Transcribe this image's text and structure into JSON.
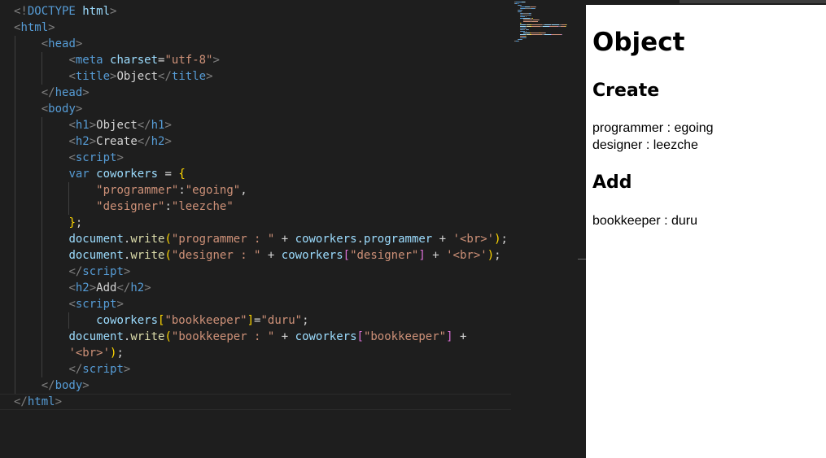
{
  "editor": {
    "lines": [
      [
        {
          "c": "c-br",
          "t": "<!"
        },
        {
          "c": "c-tag",
          "t": "DOCTYPE "
        },
        {
          "c": "c-attr",
          "t": "html"
        },
        {
          "c": "c-br",
          "t": ">"
        }
      ],
      [
        {
          "c": "c-br",
          "t": "<"
        },
        {
          "c": "c-tag",
          "t": "html"
        },
        {
          "c": "c-br",
          "t": ">"
        }
      ],
      [
        {
          "c": "c-txt",
          "t": "    "
        },
        {
          "c": "c-br",
          "t": "<"
        },
        {
          "c": "c-tag",
          "t": "head"
        },
        {
          "c": "c-br",
          "t": ">"
        }
      ],
      [
        {
          "c": "c-txt",
          "t": "        "
        },
        {
          "c": "c-br",
          "t": "<"
        },
        {
          "c": "c-tag",
          "t": "meta "
        },
        {
          "c": "c-attr",
          "t": "charset"
        },
        {
          "c": "c-txt",
          "t": "="
        },
        {
          "c": "c-str",
          "t": "\"utf-8\""
        },
        {
          "c": "c-br",
          "t": ">"
        }
      ],
      [
        {
          "c": "c-txt",
          "t": "        "
        },
        {
          "c": "c-br",
          "t": "<"
        },
        {
          "c": "c-tag",
          "t": "title"
        },
        {
          "c": "c-br",
          "t": ">"
        },
        {
          "c": "c-txt",
          "t": "Object"
        },
        {
          "c": "c-br",
          "t": "</"
        },
        {
          "c": "c-tag",
          "t": "title"
        },
        {
          "c": "c-br",
          "t": ">"
        }
      ],
      [
        {
          "c": "c-txt",
          "t": "    "
        },
        {
          "c": "c-br",
          "t": "</"
        },
        {
          "c": "c-tag",
          "t": "head"
        },
        {
          "c": "c-br",
          "t": ">"
        }
      ],
      [
        {
          "c": "c-txt",
          "t": "    "
        },
        {
          "c": "c-br",
          "t": "<"
        },
        {
          "c": "c-tag",
          "t": "body"
        },
        {
          "c": "c-br",
          "t": ">"
        }
      ],
      [
        {
          "c": "c-txt",
          "t": "        "
        },
        {
          "c": "c-br",
          "t": "<"
        },
        {
          "c": "c-tag",
          "t": "h1"
        },
        {
          "c": "c-br",
          "t": ">"
        },
        {
          "c": "c-txt",
          "t": "Object"
        },
        {
          "c": "c-br",
          "t": "</"
        },
        {
          "c": "c-tag",
          "t": "h1"
        },
        {
          "c": "c-br",
          "t": ">"
        }
      ],
      [
        {
          "c": "c-txt",
          "t": "        "
        },
        {
          "c": "c-br",
          "t": "<"
        },
        {
          "c": "c-tag",
          "t": "h2"
        },
        {
          "c": "c-br",
          "t": ">"
        },
        {
          "c": "c-txt",
          "t": "Create"
        },
        {
          "c": "c-br",
          "t": "</"
        },
        {
          "c": "c-tag",
          "t": "h2"
        },
        {
          "c": "c-br",
          "t": ">"
        }
      ],
      [
        {
          "c": "c-txt",
          "t": "        "
        },
        {
          "c": "c-br",
          "t": "<"
        },
        {
          "c": "c-tag",
          "t": "script"
        },
        {
          "c": "c-br",
          "t": ">"
        }
      ],
      [
        {
          "c": "c-txt",
          "t": "        "
        },
        {
          "c": "c-kw",
          "t": "var "
        },
        {
          "c": "c-var",
          "t": "coworkers"
        },
        {
          "c": "c-txt",
          "t": " = "
        },
        {
          "c": "c-b1",
          "t": "{"
        }
      ],
      [
        {
          "c": "c-txt",
          "t": "            "
        },
        {
          "c": "c-str",
          "t": "\"programmer\""
        },
        {
          "c": "c-txt",
          "t": ":"
        },
        {
          "c": "c-str",
          "t": "\"egoing\""
        },
        {
          "c": "c-txt",
          "t": ","
        }
      ],
      [
        {
          "c": "c-txt",
          "t": "            "
        },
        {
          "c": "c-str",
          "t": "\"designer\""
        },
        {
          "c": "c-txt",
          "t": ":"
        },
        {
          "c": "c-str",
          "t": "\"leezche\""
        }
      ],
      [
        {
          "c": "c-txt",
          "t": "        "
        },
        {
          "c": "c-b1",
          "t": "}"
        },
        {
          "c": "c-txt",
          "t": ";"
        }
      ],
      [
        {
          "c": "c-txt",
          "t": "        "
        },
        {
          "c": "c-var",
          "t": "document"
        },
        {
          "c": "c-txt",
          "t": "."
        },
        {
          "c": "c-fn",
          "t": "write"
        },
        {
          "c": "c-b1",
          "t": "("
        },
        {
          "c": "c-str",
          "t": "\"programmer : \""
        },
        {
          "c": "c-txt",
          "t": " + "
        },
        {
          "c": "c-var",
          "t": "coworkers"
        },
        {
          "c": "c-txt",
          "t": "."
        },
        {
          "c": "c-var",
          "t": "programmer"
        },
        {
          "c": "c-txt",
          "t": " + "
        },
        {
          "c": "c-str",
          "t": "'<br>'"
        },
        {
          "c": "c-b1",
          "t": ")"
        },
        {
          "c": "c-txt",
          "t": ";"
        }
      ],
      [
        {
          "c": "c-txt",
          "t": "        "
        },
        {
          "c": "c-var",
          "t": "document"
        },
        {
          "c": "c-txt",
          "t": "."
        },
        {
          "c": "c-fn",
          "t": "write"
        },
        {
          "c": "c-b1",
          "t": "("
        },
        {
          "c": "c-str",
          "t": "\"designer : \""
        },
        {
          "c": "c-txt",
          "t": " + "
        },
        {
          "c": "c-var",
          "t": "coworkers"
        },
        {
          "c": "c-b2",
          "t": "["
        },
        {
          "c": "c-str",
          "t": "\"designer\""
        },
        {
          "c": "c-b2",
          "t": "]"
        },
        {
          "c": "c-txt",
          "t": " + "
        },
        {
          "c": "c-str",
          "t": "'<br>'"
        },
        {
          "c": "c-b1",
          "t": ")"
        },
        {
          "c": "c-txt",
          "t": ";"
        }
      ],
      [
        {
          "c": "c-txt",
          "t": "        "
        },
        {
          "c": "c-br",
          "t": "</"
        },
        {
          "c": "c-tag",
          "t": "script"
        },
        {
          "c": "c-br",
          "t": ">"
        }
      ],
      [
        {
          "c": "c-txt",
          "t": "        "
        },
        {
          "c": "c-br",
          "t": "<"
        },
        {
          "c": "c-tag",
          "t": "h2"
        },
        {
          "c": "c-br",
          "t": ">"
        },
        {
          "c": "c-txt",
          "t": "Add"
        },
        {
          "c": "c-br",
          "t": "</"
        },
        {
          "c": "c-tag",
          "t": "h2"
        },
        {
          "c": "c-br",
          "t": ">"
        }
      ],
      [
        {
          "c": "c-txt",
          "t": "        "
        },
        {
          "c": "c-br",
          "t": "<"
        },
        {
          "c": "c-tag",
          "t": "script"
        },
        {
          "c": "c-br",
          "t": ">"
        }
      ],
      [
        {
          "c": "c-txt",
          "t": "            "
        },
        {
          "c": "c-var",
          "t": "coworkers"
        },
        {
          "c": "c-b1",
          "t": "["
        },
        {
          "c": "c-str",
          "t": "\"bookkeeper\""
        },
        {
          "c": "c-b1",
          "t": "]"
        },
        {
          "c": "c-txt",
          "t": "="
        },
        {
          "c": "c-str",
          "t": "\"duru\""
        },
        {
          "c": "c-txt",
          "t": ";"
        }
      ],
      [
        {
          "c": "c-txt",
          "t": "        "
        },
        {
          "c": "c-var",
          "t": "document"
        },
        {
          "c": "c-txt",
          "t": "."
        },
        {
          "c": "c-fn",
          "t": "write"
        },
        {
          "c": "c-b1",
          "t": "("
        },
        {
          "c": "c-str",
          "t": "\"bookkeeper : \""
        },
        {
          "c": "c-txt",
          "t": " + "
        },
        {
          "c": "c-var",
          "t": "coworkers"
        },
        {
          "c": "c-b2",
          "t": "["
        },
        {
          "c": "c-str",
          "t": "\"bookkeeper\""
        },
        {
          "c": "c-b2",
          "t": "]"
        },
        {
          "c": "c-txt",
          "t": " +"
        }
      ],
      [
        {
          "c": "c-txt",
          "t": "        "
        },
        {
          "c": "c-str",
          "t": "'<br>'"
        },
        {
          "c": "c-b1",
          "t": ")"
        },
        {
          "c": "c-txt",
          "t": ";"
        }
      ],
      [
        {
          "c": "c-txt",
          "t": "        "
        },
        {
          "c": "c-br",
          "t": "</"
        },
        {
          "c": "c-tag",
          "t": "script"
        },
        {
          "c": "c-br",
          "t": ">"
        }
      ],
      [
        {
          "c": "c-txt",
          "t": "    "
        },
        {
          "c": "c-br",
          "t": "</"
        },
        {
          "c": "c-tag",
          "t": "body"
        },
        {
          "c": "c-br",
          "t": ">"
        }
      ],
      [
        {
          "c": "c-br",
          "t": "</"
        },
        {
          "c": "c-tag",
          "t": "html"
        },
        {
          "c": "c-br",
          "t": ">"
        }
      ]
    ]
  },
  "preview": {
    "h1": "Object",
    "h2_create": "Create",
    "line_programmer": "programmer : egoing",
    "line_designer": "designer : leezche",
    "h2_add": "Add",
    "line_bookkeeper": "bookkeeper : duru"
  },
  "colors": {
    "editor_bg": "#1e1e1e",
    "tag": "#569cd6",
    "attribute": "#9cdcfe",
    "string": "#ce9178",
    "function": "#dcdcaa",
    "bracket_gold": "#ffd700",
    "bracket_purple": "#da70d6"
  }
}
